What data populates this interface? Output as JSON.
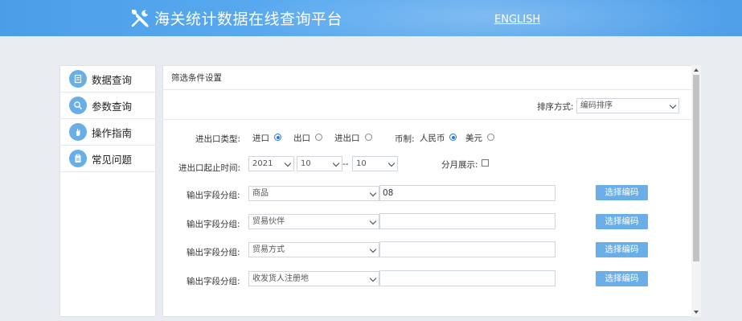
{
  "header": {
    "title": "海关统计数据在线查询平台",
    "lang_link": "ENGLISH",
    "logo_icon": "tools-icon"
  },
  "sidebar": {
    "items": [
      {
        "label": "数据查询",
        "icon": "document-icon"
      },
      {
        "label": "参数查询",
        "icon": "search-icon"
      },
      {
        "label": "操作指南",
        "icon": "hand-icon"
      },
      {
        "label": "常见问题",
        "icon": "clipboard-icon"
      }
    ]
  },
  "panel": {
    "title": "筛选条件设置",
    "sort": {
      "label": "排序方式:",
      "value": "编码排序"
    },
    "trade_type": {
      "label": "进出口类型:",
      "options": [
        "进口",
        "出口",
        "进出口"
      ],
      "selected": "进口"
    },
    "currency": {
      "label": "币制:",
      "options": [
        "人民币",
        "美元"
      ],
      "selected": "人民币"
    },
    "period": {
      "label": "进出口起止时间:",
      "year": "2021",
      "start_month": "10",
      "separator": "--",
      "end_month": "10"
    },
    "monthly_display": {
      "label": "分月展示:",
      "checked": false
    },
    "output_groups": [
      {
        "label": "输出字段分组:",
        "select": "商品",
        "code": "08",
        "button": "选择编码"
      },
      {
        "label": "输出字段分组:",
        "select": "贸易伙伴",
        "code": "",
        "button": "选择编码"
      },
      {
        "label": "输出字段分组:",
        "select": "贸易方式",
        "code": "",
        "button": "选择编码"
      },
      {
        "label": "输出字段分组:",
        "select": "收发货人注册地",
        "code": "",
        "button": "选择编码"
      }
    ]
  },
  "colors": {
    "header_blue": "#4a9ee8",
    "button_blue": "#6aaee8",
    "radio_blue": "#1e7ae0"
  }
}
